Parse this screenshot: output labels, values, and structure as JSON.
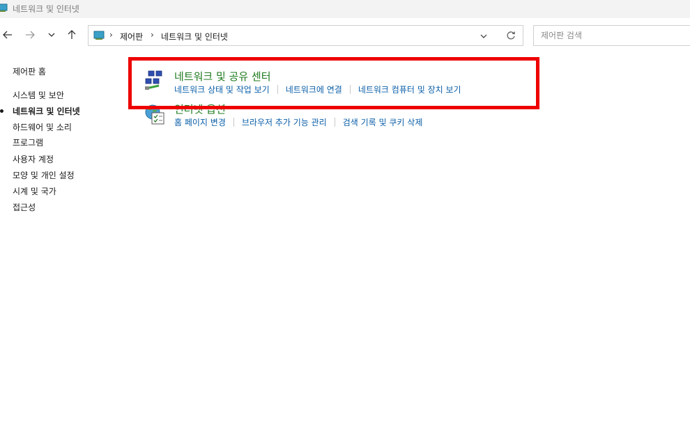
{
  "window": {
    "title": "네트워크 및 인터넷"
  },
  "address_bar": {
    "crumbs": [
      "제어판",
      "네트워크 및 인터넷"
    ]
  },
  "search": {
    "placeholder": "제어판 검색"
  },
  "sidebar": {
    "home": "제어판 홈",
    "items": [
      {
        "label": "시스템 및 보안",
        "active": false
      },
      {
        "label": "네트워크 및 인터넷",
        "active": true
      },
      {
        "label": "하드웨어 및 소리",
        "active": false
      },
      {
        "label": "프로그램",
        "active": false
      },
      {
        "label": "사용자 계정",
        "active": false
      },
      {
        "label": "모양 및 개인 설정",
        "active": false
      },
      {
        "label": "시계 및 국가",
        "active": false
      },
      {
        "label": "접근성",
        "active": false
      }
    ]
  },
  "categories": [
    {
      "title": "네트워크 및 공유 센터",
      "icon": "network-sharing-center-icon",
      "links": [
        "네트워크 상태 및 작업 보기",
        "네트워크에 연결",
        "네트워크 컴퓨터 및 장치 보기"
      ]
    },
    {
      "title": "인터넷 옵션",
      "icon": "internet-options-icon",
      "links": [
        "홈 페이지 변경",
        "브라우저 추가 기능 관리",
        "검색 기록 및 쿠키 삭제"
      ]
    }
  ],
  "colors": {
    "highlight": "#ee0000",
    "category_title": "#1e7a1e",
    "link": "#0a5ea8"
  }
}
